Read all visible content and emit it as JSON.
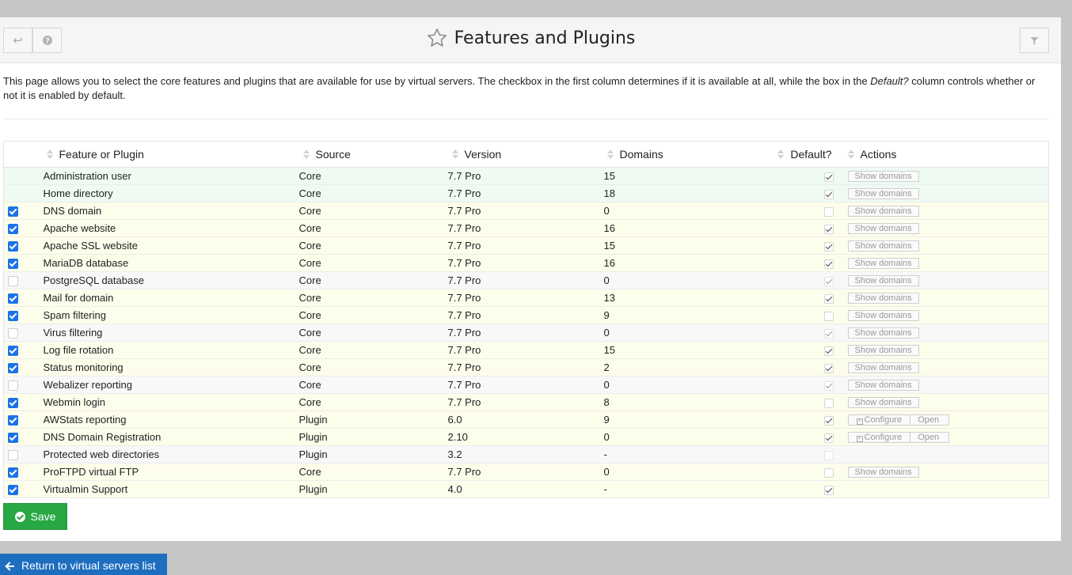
{
  "page": {
    "title": "Features and Plugins",
    "intro_part1": "This page allows you to select the core features and plugins that are available for use by virtual servers. The checkbox in the first column determines if it is available at all, while the box in the ",
    "intro_em": "Default?",
    "intro_part2": " column controls whether or not it is enabled by default."
  },
  "toolbar": {
    "back_icon": "return-arrow-icon",
    "help_icon": "question-circle-icon",
    "filter_icon": "funnel-filter-icon",
    "title_icon": "star-outline-icon"
  },
  "table": {
    "headers": {
      "feature": "Feature or Plugin",
      "source": "Source",
      "version": "Version",
      "domains": "Domains",
      "default": "Default?",
      "actions": "Actions"
    },
    "rows": [
      {
        "enabled": null,
        "name": "Administration user",
        "source": "Core",
        "version": "7.7 Pro",
        "domains": "15",
        "default": "on-dark",
        "actions": "show",
        "bg": "green"
      },
      {
        "enabled": null,
        "name": "Home directory",
        "source": "Core",
        "version": "7.7 Pro",
        "domains": "18",
        "default": "on-dark",
        "actions": "show",
        "bg": "green"
      },
      {
        "enabled": true,
        "name": "DNS domain",
        "source": "Core",
        "version": "7.7 Pro",
        "domains": "0",
        "default": "off",
        "actions": "show",
        "bg": "yellow"
      },
      {
        "enabled": true,
        "name": "Apache website",
        "source": "Core",
        "version": "7.7 Pro",
        "domains": "16",
        "default": "on-dark",
        "actions": "show",
        "bg": "yellow"
      },
      {
        "enabled": true,
        "name": "Apache SSL website",
        "source": "Core",
        "version": "7.7 Pro",
        "domains": "15",
        "default": "on-dark",
        "actions": "show",
        "bg": "yellow"
      },
      {
        "enabled": true,
        "name": "MariaDB database",
        "source": "Core",
        "version": "7.7 Pro",
        "domains": "16",
        "default": "on-dark",
        "actions": "show",
        "bg": "yellow"
      },
      {
        "enabled": false,
        "name": "PostgreSQL database",
        "source": "Core",
        "version": "7.7 Pro",
        "domains": "0",
        "default": "on-dim",
        "actions": "show",
        "bg": "grey"
      },
      {
        "enabled": true,
        "name": "Mail for domain",
        "source": "Core",
        "version": "7.7 Pro",
        "domains": "13",
        "default": "on-dark",
        "actions": "show",
        "bg": "yellow"
      },
      {
        "enabled": true,
        "name": "Spam filtering",
        "source": "Core",
        "version": "7.7 Pro",
        "domains": "9",
        "default": "off",
        "actions": "show",
        "bg": "yellow"
      },
      {
        "enabled": false,
        "name": "Virus filtering",
        "source": "Core",
        "version": "7.7 Pro",
        "domains": "0",
        "default": "on-dim",
        "actions": "show",
        "bg": "grey"
      },
      {
        "enabled": true,
        "name": "Log file rotation",
        "source": "Core",
        "version": "7.7 Pro",
        "domains": "15",
        "default": "on-dark",
        "actions": "show",
        "bg": "yellow"
      },
      {
        "enabled": true,
        "name": "Status monitoring",
        "source": "Core",
        "version": "7.7 Pro",
        "domains": "2",
        "default": "on-dark",
        "actions": "show",
        "bg": "yellow"
      },
      {
        "enabled": false,
        "name": "Webalizer reporting",
        "source": "Core",
        "version": "7.7 Pro",
        "domains": "0",
        "default": "on-dim",
        "actions": "show",
        "bg": "grey"
      },
      {
        "enabled": true,
        "name": "Webmin login",
        "source": "Core",
        "version": "7.7 Pro",
        "domains": "8",
        "default": "off",
        "actions": "show",
        "bg": "yellow"
      },
      {
        "enabled": true,
        "name": "AWStats reporting",
        "source": "Plugin",
        "version": "6.0",
        "domains": "9",
        "default": "on-dark",
        "actions": "configure",
        "bg": "yellow"
      },
      {
        "enabled": true,
        "name": "DNS Domain Registration",
        "source": "Plugin",
        "version": "2.10",
        "domains": "0",
        "default": "on-dark",
        "actions": "configure",
        "bg": "yellow"
      },
      {
        "enabled": false,
        "name": "Protected web directories",
        "source": "Plugin",
        "version": "3.2",
        "domains": "-",
        "default": "off-dim",
        "actions": "none",
        "bg": "grey"
      },
      {
        "enabled": true,
        "name": "ProFTPD virtual FTP",
        "source": "Core",
        "version": "7.7 Pro",
        "domains": "0",
        "default": "off",
        "actions": "show",
        "bg": "yellow"
      },
      {
        "enabled": true,
        "name": "Virtualmin Support",
        "source": "Plugin",
        "version": "4.0",
        "domains": "-",
        "default": "on-dark",
        "actions": "none",
        "bg": "yellow"
      }
    ],
    "show_domains_label": "Show domains",
    "configure_label": "Configure",
    "open_label": "Open"
  },
  "buttons": {
    "save_label": "Save",
    "return_label": "Return to virtual servers list"
  },
  "colors": {
    "save_green": "#27a844",
    "return_blue": "#1e6ebf",
    "checkbox_blue": "#1a73e8",
    "row_green": "#effaf2",
    "row_yellow": "#fdfdeb"
  }
}
